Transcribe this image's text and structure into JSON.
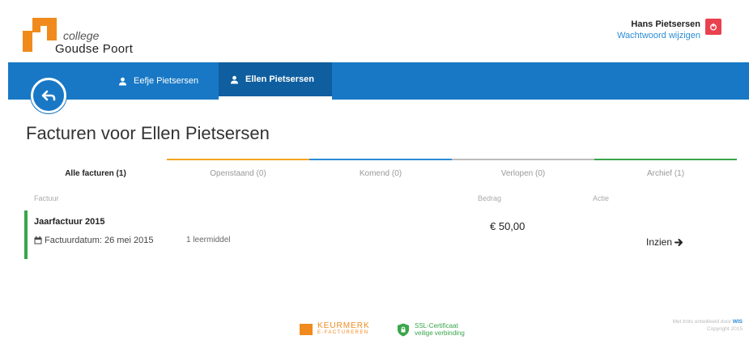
{
  "header": {
    "logo_line1": "college",
    "logo_line2": "Goudse Poort",
    "user_name": "Hans Pietsersen",
    "change_password": "Wachtwoord wijzigen",
    "logout_icon": "power-icon",
    "brand_orange": "#f08a1c",
    "logout_color": "#e8424e"
  },
  "nav": {
    "color": "#1878c5",
    "back_icon": "back-arrow-icon",
    "tabs": [
      {
        "label": "Eefje Pietsersen",
        "icon": "user-icon",
        "active": false
      },
      {
        "label": "Ellen Pietsersen",
        "icon": "user-icon",
        "active": true
      }
    ]
  },
  "page": {
    "title": "Facturen voor Ellen Pietsersen"
  },
  "filters": [
    {
      "label": "Alle facturen (1)",
      "active": true,
      "color": "transparent"
    },
    {
      "label": "Openstaand (0)",
      "active": false,
      "color": "#f5a623"
    },
    {
      "label": "Komend (0)",
      "active": false,
      "color": "#2b8cd6"
    },
    {
      "label": "Verlopen (0)",
      "active": false,
      "color": "#bbbbbb"
    },
    {
      "label": "Archief (1)",
      "active": false,
      "color": "#3aa54a"
    }
  ],
  "table": {
    "headers": {
      "invoice": "Factuur",
      "amount": "Bedrag",
      "action": "Actie"
    },
    "rows": [
      {
        "title": "Jaarfactuur 2015",
        "date_label": "Factuurdatum: 26 mei 2015",
        "items": "1 leermiddel",
        "amount": "€ 50,00",
        "view_label": "Inzien",
        "status_color": "#3aa54a"
      }
    ]
  },
  "footer": {
    "keurmerk": "KEURMERK",
    "keurmerk_sub": "E-FACTUREREN",
    "ssl_line1": "SSL-Certificaat",
    "ssl_line2": "veilige verbinding",
    "powered_line1": "Met trots ontwikkeld door",
    "powered_brand": "WIS",
    "powered_line2": "Copyright 2015"
  }
}
